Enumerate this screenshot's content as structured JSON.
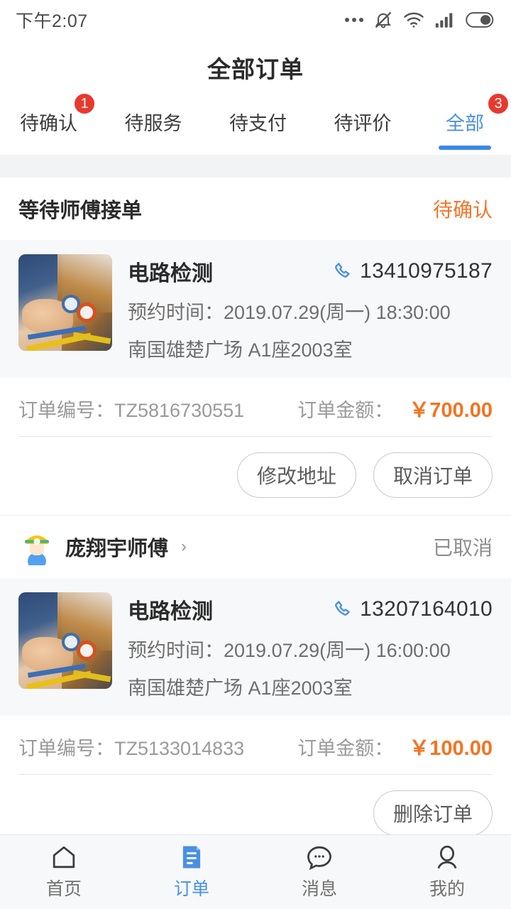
{
  "status_bar": {
    "time": "下午2:07",
    "icons": [
      "more-dots-icon",
      "mute-bell-icon",
      "wifi-icon",
      "signal-icon",
      "battery-icon"
    ]
  },
  "header": {
    "title": "全部订单"
  },
  "tabs": [
    {
      "label": "待确认",
      "badge": "1",
      "active": false
    },
    {
      "label": "待服务",
      "badge": "",
      "active": false
    },
    {
      "label": "待支付",
      "badge": "",
      "active": false
    },
    {
      "label": "待评价",
      "badge": "",
      "active": false
    },
    {
      "label": "全部",
      "badge": "3",
      "active": true
    }
  ],
  "orders": [
    {
      "head_title": "等待师傅接单",
      "status": "待确认",
      "service_name": "电路检测",
      "phone": "13410975187",
      "appointment": "预约时间：2019.07.29(周一) 18:30:00",
      "address": "南国雄楚广场 A1座2003室",
      "order_no_label": "订单编号：TZ5816730551",
      "amount_label": "订单金额：",
      "amount": "￥700.00",
      "buttons": [
        "修改地址",
        "取消订单"
      ]
    },
    {
      "master_name": "庞翔宇师傅",
      "status": "已取消",
      "service_name": "电路检测",
      "phone": "13207164010",
      "appointment": "预约时间：2019.07.29(周一) 16:00:00",
      "address": "南国雄楚广场 A1座2003室",
      "order_no_label": "订单编号：TZ5133014833",
      "amount_label": "订单金额：",
      "amount": "￥100.00",
      "buttons": [
        "删除订单"
      ]
    }
  ],
  "bottom_nav": [
    {
      "label": "首页",
      "icon": "home-icon",
      "active": false
    },
    {
      "label": "订单",
      "icon": "order-doc-icon",
      "active": true
    },
    {
      "label": "消息",
      "icon": "message-bubble-icon",
      "active": false
    },
    {
      "label": "我的",
      "icon": "person-icon",
      "active": false
    }
  ],
  "colors": {
    "accent_blue": "#4a90e2",
    "badge_red": "#e8392f",
    "price_orange": "#f5731f",
    "status_pending_orange": "#f5752a",
    "muted_gray": "#8d8d8d",
    "page_bg": "#f2f3f5"
  }
}
